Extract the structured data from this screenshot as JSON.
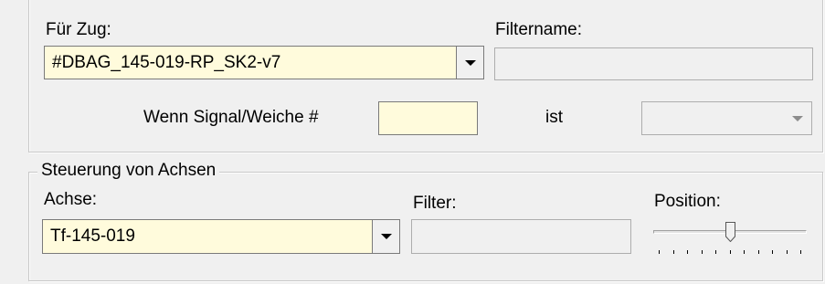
{
  "train_section": {
    "label": "Für Zug:",
    "value": "#DBAG_145-019-RP_SK2-v7",
    "filter_name_label": "Filtername:",
    "filter_name_value": "",
    "signal_label": "Wenn Signal/Weiche #",
    "signal_value": "",
    "is_label": "ist",
    "state_value": ""
  },
  "axis_section": {
    "legend": "Steuerung von Achsen",
    "axis_label": "Achse:",
    "axis_value": "Tf-145-019",
    "filter_label": "Filter:",
    "filter_value": "",
    "position_label": "Position:",
    "position_tick_count": 11,
    "position_value_tick": 5
  },
  "icons": {
    "dropdown": "chevron-down-icon"
  },
  "colors": {
    "input_highlight": "#fffbdc",
    "window_bg": "#f0f0f0"
  }
}
